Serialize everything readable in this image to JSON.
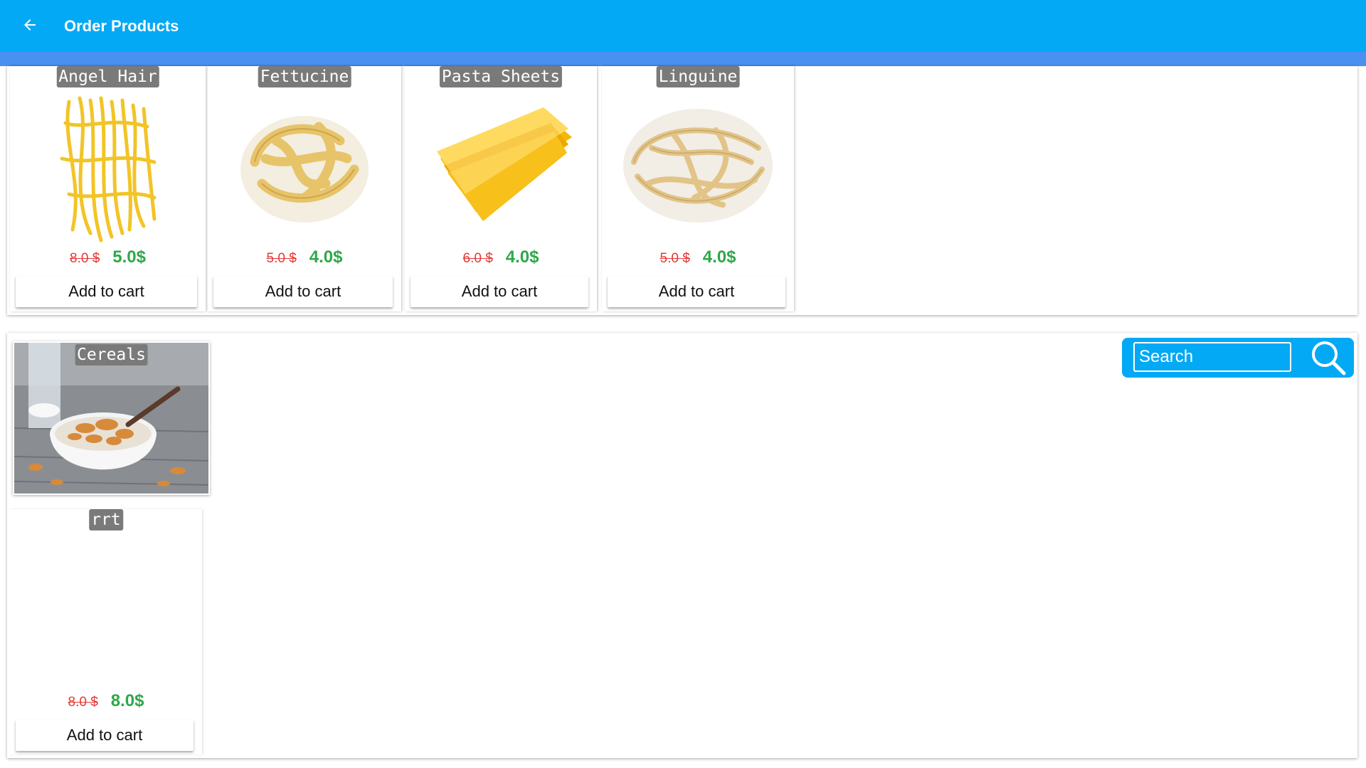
{
  "app": {
    "title": "Order Products",
    "accent": "#03A9F4"
  },
  "products": [
    {
      "name": "Angel Hair",
      "old_price": "8.0 $",
      "new_price": "5.0$",
      "button": "Add to cart"
    },
    {
      "name": "Fettucine",
      "old_price": "5.0 $",
      "new_price": "4.0$",
      "button": "Add to cart"
    },
    {
      "name": "Pasta Sheets",
      "old_price": "6.0 $",
      "new_price": "4.0$",
      "button": "Add to cart"
    },
    {
      "name": "Linguine",
      "old_price": "5.0 $",
      "new_price": "4.0$",
      "button": "Add to cart"
    }
  ],
  "category": {
    "name": "Cereals"
  },
  "extra_product": {
    "name": "rrt",
    "old_price": "8.0 $",
    "new_price": "8.0$",
    "button": "Add to cart"
  },
  "search": {
    "placeholder": "Search"
  },
  "colors": {
    "old_price": "#e53935",
    "new_price": "#2ea84a"
  }
}
